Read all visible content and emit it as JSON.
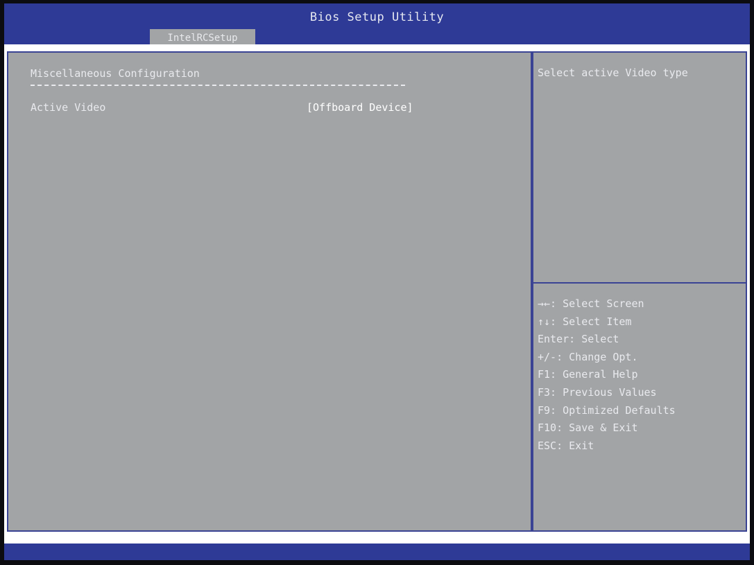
{
  "window": {
    "title": "Bios Setup Utility",
    "active_tab": "IntelRCSetup"
  },
  "main": {
    "section_title": "Miscellaneous Configuration",
    "separator": "----------------------------------------------------",
    "settings": [
      {
        "label": "Active Video",
        "value": "[Offboard Device]"
      }
    ]
  },
  "help": {
    "description": "Select active Video type",
    "keys": [
      "→←: Select Screen",
      "↑↓: Select Item",
      "Enter: Select",
      "+/-: Change Opt.",
      "F1: General Help",
      "F3: Previous Values",
      "F9: Optimized Defaults",
      "F10: Save & Exit",
      "ESC: Exit"
    ]
  },
  "colors": {
    "title_bar": "#2e3a96",
    "panel": "#a2a4a6",
    "border": "#3a4394",
    "text": "#e9eaee"
  }
}
